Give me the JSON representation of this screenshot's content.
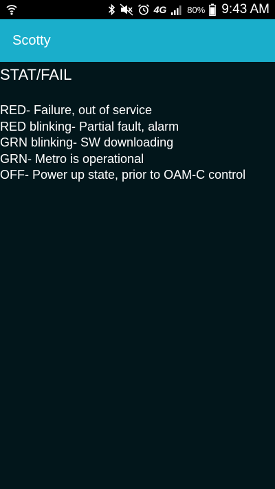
{
  "status_bar": {
    "icons": [
      "wifi-icon",
      "bluetooth-icon",
      "mute-icon",
      "alarm-icon",
      "signal-icon",
      "battery-icon"
    ],
    "network": "4G",
    "battery_pct": "80%",
    "time": "9:43 AM"
  },
  "app_bar": {
    "title": "Scotty",
    "color": "#1aaecb"
  },
  "content": {
    "heading": "STAT/FAIL",
    "items": [
      "RED- Failure, out of service",
      "RED blinking- Partial fault, alarm",
      "GRN blinking- SW downloading",
      "GRN- Metro is operational",
      "OFF- Power up state, prior to OAM-C control"
    ],
    "background": "#02161b"
  }
}
